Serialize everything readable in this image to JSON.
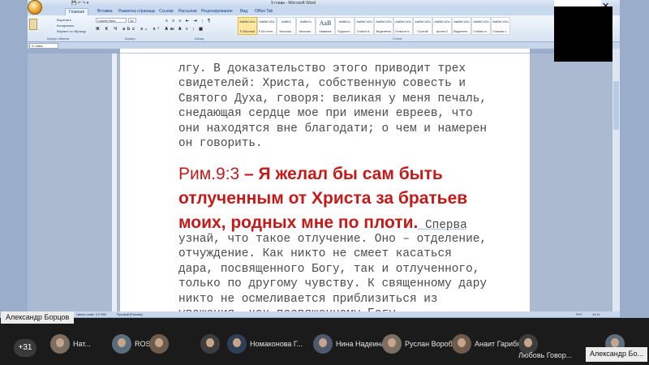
{
  "app": {
    "window_title": "9 глава - Microsoft Word",
    "doc_tab": "9 глава"
  },
  "ribbon": {
    "tabs": [
      "Главная",
      "Вставка",
      "Разметка страницы",
      "Ссылки",
      "Рассылки",
      "Рецензирование",
      "Вид",
      "Office Tab"
    ],
    "clipboard": [
      "Вырезать",
      "Копировать",
      "Формат по образцу"
    ],
    "font_name": "Courier New",
    "font_size": "16",
    "groups": [
      "Буфер обмена",
      "Шрифт",
      "Абзац",
      "Стили"
    ],
    "styles": [
      {
        "sample": "AaBbCcDc",
        "name": "¶ Обычный"
      },
      {
        "sample": "AaBbCcDc",
        "name": "¶ Без инте..."
      },
      {
        "sample": "AaBbC",
        "name": "Заголово..."
      },
      {
        "sample": "AaBbCc",
        "name": "Заголово..."
      },
      {
        "sample": "AaB",
        "name": "Название"
      },
      {
        "sample": "AaBbCc",
        "name": "Подзагол..."
      },
      {
        "sample": "AaBbCcDc",
        "name": "Слабое в..."
      },
      {
        "sample": "AaBbCcDc",
        "name": "Выделение"
      },
      {
        "sample": "AaBbCcDc",
        "name": "Сильное в..."
      },
      {
        "sample": "AaBbCcDc",
        "name": "Строгий"
      },
      {
        "sample": "AaBbCcDc",
        "name": "Цитата 2"
      },
      {
        "sample": "AaBbCcDc",
        "name": "Выделенн..."
      },
      {
        "sample": "AaBbCcDc",
        "name": "Слабая сс..."
      },
      {
        "sample": "AaBbCcDc",
        "name": "Сильная с..."
      }
    ]
  },
  "document": {
    "paragraph1": "лгу. В доказательство этого приводит трех свидетелей: Христа, собственную совесть и Святого Духа, говоря: великая у меня печаль, снедающая сердце мое при имени евреев, что они находятся вне благодати; о чем и намерен он говорить.",
    "heading_ref": "Рим.9:3",
    "heading_text": " – Я желал бы сам быть отлученным от Христа за братьев моих, родных мне по плоти.",
    "heading_tail": " Сперва",
    "paragraph2": "узнай, что такое отлучение. Оно – отделение, отчуждение. Как никто не смеет касаться дара, посвященного Богу, так и отлученного, только по другому чувству. К священному дару никто не осмеливается приблизиться из уважения, как посвященному Богу..."
  },
  "statusbar": {
    "words": "Число слов: 3 2 950",
    "language": "Русский (Россия)",
    "lang_indicator": "РУС",
    "time": "14:11"
  },
  "conference": {
    "name_tag": "Александр Борцов",
    "participant_count": "+31",
    "participants": [
      "Нат...",
      "ROS...",
      "",
      "",
      "Номаконова Г...",
      "Нина Надеина",
      "Руслан Вороб...",
      "Анаит Гарибян",
      "Любовь Говор...",
      "Александр Бо..."
    ]
  }
}
